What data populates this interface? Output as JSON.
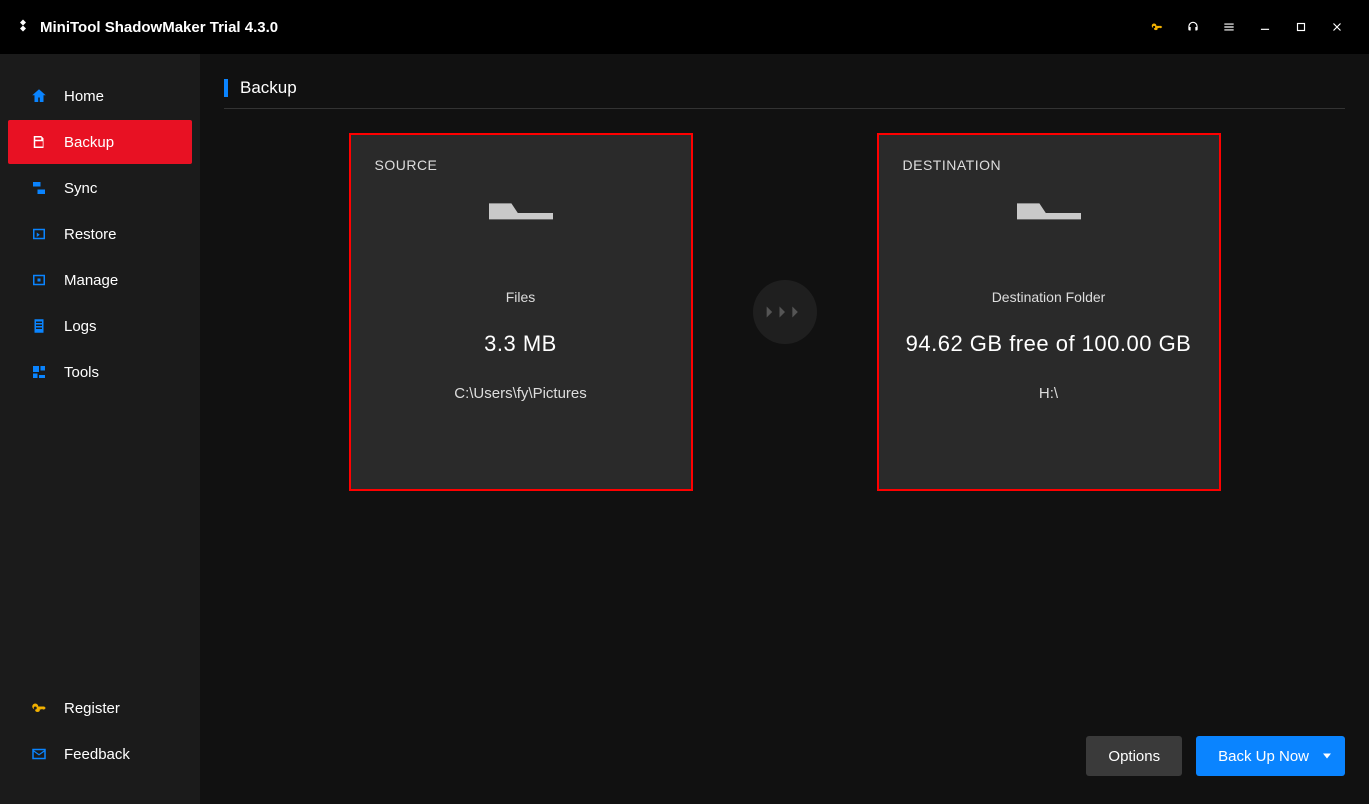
{
  "app": {
    "title": "MiniTool ShadowMaker Trial 4.3.0"
  },
  "sidebar": {
    "items": [
      {
        "label": "Home"
      },
      {
        "label": "Backup"
      },
      {
        "label": "Sync"
      },
      {
        "label": "Restore"
      },
      {
        "label": "Manage"
      },
      {
        "label": "Logs"
      },
      {
        "label": "Tools"
      }
    ],
    "register": "Register",
    "feedback": "Feedback"
  },
  "page": {
    "title": "Backup"
  },
  "source": {
    "heading": "SOURCE",
    "type": "Files",
    "size": "3.3 MB",
    "path": "C:\\Users\\fy\\Pictures"
  },
  "destination": {
    "heading": "DESTINATION",
    "type": "Destination Folder",
    "space": "94.62 GB free of 100.00 GB",
    "path": "H:\\"
  },
  "footer": {
    "options": "Options",
    "backup": "Back Up Now"
  }
}
